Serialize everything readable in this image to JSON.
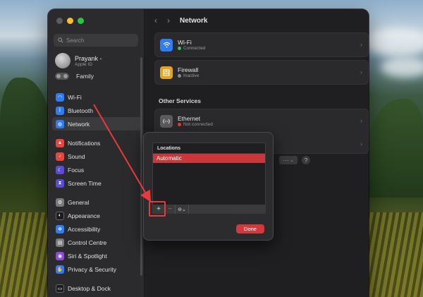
{
  "window": {
    "title": "Network"
  },
  "sidebar": {
    "search_placeholder": "Search",
    "account": {
      "name": "Prayank -",
      "subtitle": "Apple ID"
    },
    "family": "Family",
    "items": [
      {
        "label": "Wi-Fi",
        "icon": "wifi-icon",
        "color": "#2f7cf6"
      },
      {
        "label": "Bluetooth",
        "icon": "bluetooth-icon",
        "color": "#2f7cf6"
      },
      {
        "label": "Network",
        "icon": "globe-icon",
        "color": "#2f7cf6",
        "selected": true
      },
      {
        "label": "Notifications",
        "icon": "bell-icon",
        "color": "#e8453c"
      },
      {
        "label": "Sound",
        "icon": "speaker-icon",
        "color": "#e8453c"
      },
      {
        "label": "Focus",
        "icon": "moon-icon",
        "color": "#5b4bd6"
      },
      {
        "label": "Screen Time",
        "icon": "hourglass-icon",
        "color": "#5b4bd6"
      },
      {
        "label": "General",
        "icon": "gear-icon",
        "color": "#7a7a7c"
      },
      {
        "label": "Appearance",
        "icon": "appearance-icon",
        "color": "#1c1c1e"
      },
      {
        "label": "Accessibility",
        "icon": "accessibility-icon",
        "color": "#2f7cf6"
      },
      {
        "label": "Control Centre",
        "icon": "control-centre-icon",
        "color": "#7a7a7c"
      },
      {
        "label": "Siri & Spotlight",
        "icon": "siri-icon",
        "color": "#8a4bd6"
      },
      {
        "label": "Privacy & Security",
        "icon": "hand-icon",
        "color": "#2f7cf6"
      },
      {
        "label": "Desktop & Dock",
        "icon": "dock-icon",
        "color": "#1c1c1e"
      }
    ]
  },
  "main": {
    "services": [
      {
        "title": "Wi-Fi",
        "status": "Connected",
        "status_color": "#3cc14d",
        "icon": "wifi-icon",
        "color": "#2f7cf6"
      },
      {
        "title": "Firewall",
        "status": "Inactive",
        "status_color": "#8a8a8c",
        "icon": "firewall-icon",
        "color": "#e0a623"
      }
    ],
    "other_services_title": "Other Services",
    "other_services": [
      {
        "title": "Ethernet",
        "status": "Not connected",
        "status_color": "#e0403a",
        "icon": "ethernet-icon",
        "color": "#5c5c5e"
      }
    ],
    "more_label": "···",
    "help_label": "?"
  },
  "sheet": {
    "header": "Locations",
    "locations": [
      "Automatic"
    ],
    "add_label": "+",
    "remove_label": "−",
    "action_label": "⊖⌄",
    "done_label": "Done",
    "accent": "#d2393c"
  }
}
